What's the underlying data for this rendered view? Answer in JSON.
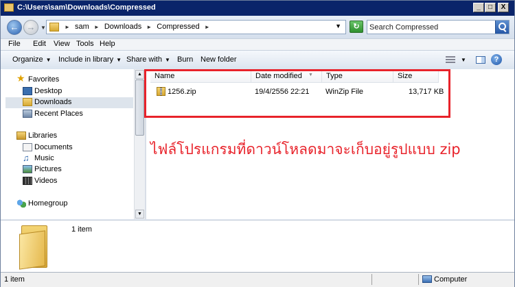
{
  "window": {
    "title": "C:\\Users\\sam\\Downloads\\Compressed",
    "controls": {
      "minimize": "_",
      "maximize": "□",
      "close": "X"
    }
  },
  "address": {
    "breadcrumbs": [
      "sam",
      "Downloads",
      "Compressed"
    ],
    "search_placeholder": "Search Compressed"
  },
  "menu": [
    "File",
    "Edit",
    "View",
    "Tools",
    "Help"
  ],
  "toolbar": {
    "organize": "Organize",
    "include_in_library": "Include in library",
    "share_with": "Share with",
    "burn": "Burn",
    "new_folder": "New folder"
  },
  "nav": {
    "favorites": {
      "header": "Favorites",
      "items": [
        "Desktop",
        "Downloads",
        "Recent Places"
      ],
      "selected": "Downloads"
    },
    "libraries": {
      "header": "Libraries",
      "items": [
        "Documents",
        "Music",
        "Pictures",
        "Videos"
      ]
    },
    "homegroup": "Homegroup"
  },
  "columns": [
    "Name",
    "Date modified",
    "Type",
    "Size"
  ],
  "files": [
    {
      "name": "1256.zip",
      "date": "19/4/2556 22:21",
      "type": "WinZip File",
      "size": "13,717 KB"
    }
  ],
  "annotation": "ไฟล์โปรแกรมที่ดาวน์โหลดมาจะเก็บอยู่รูปแบบ   zip",
  "details": {
    "count": "1 item"
  },
  "status": {
    "left": "1 item",
    "right": "Computer"
  },
  "colors": {
    "annotation": "#e8222a",
    "titlebar": "#0a246a"
  }
}
